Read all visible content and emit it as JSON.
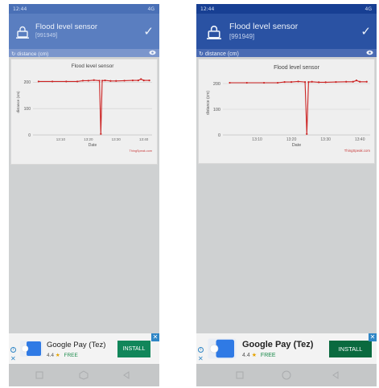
{
  "status": {
    "time": "12:44",
    "signal_text": "4G"
  },
  "app": {
    "title": "Flood level sensor",
    "channel_id": "[991949]"
  },
  "sensor": {
    "label": "distance (cm)"
  },
  "chart_data": {
    "type": "line",
    "title": "Flood level sensor",
    "xlabel": "Date",
    "ylabel": "distance (cm)",
    "ylim": [
      0,
      250
    ],
    "yticks": [
      "0",
      "100",
      "200"
    ],
    "xticks": [
      "13:10",
      "13:20",
      "13:30",
      "13:40"
    ],
    "credit": "ThingSpeak.com",
    "series": [
      {
        "x": [
          "13:02",
          "13:07",
          "13:12",
          "13:16",
          "13:18",
          "13:20",
          "13:22",
          "13:24",
          "13:24.5",
          "13:25",
          "13:26",
          "13:28",
          "13:30",
          "13:33",
          "13:36",
          "13:38",
          "13:39",
          "13:40",
          "13:42"
        ],
        "y": [
          203,
          203,
          203,
          203,
          206,
          206,
          208,
          206,
          4,
          206,
          207,
          205,
          205,
          206,
          207,
          207,
          212,
          207,
          207
        ]
      }
    ],
    "color": "#cc2222"
  },
  "ad": {
    "name": "Google Pay (Tez)",
    "rating": "4.4",
    "price": "FREE",
    "cta": "INSTALL",
    "logo_text": "G Pay",
    "info_icon": "i",
    "close_symbol": "✕"
  },
  "icons": {
    "lock": "lock-icon",
    "check": "check-icon",
    "refresh": "refresh-icon",
    "eye": "eye-icon",
    "back": "nav-back-icon",
    "home": "nav-home-icon",
    "recents": "nav-recents-icon"
  }
}
